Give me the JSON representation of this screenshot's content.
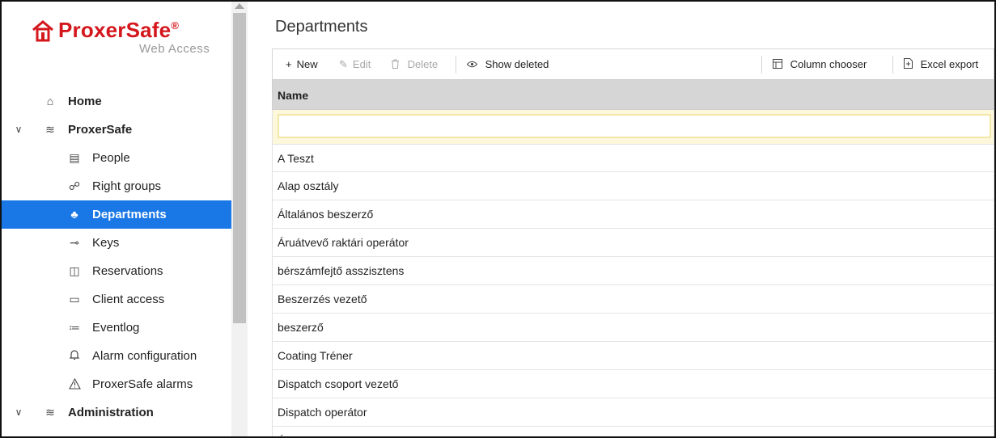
{
  "brand": {
    "name": "ProxerSafe",
    "registered": "®",
    "subtitle": "Web Access",
    "color": "#d4171d"
  },
  "sidebar": {
    "accent": "#1a78e6",
    "items": [
      {
        "label": "Home",
        "icon": "home-icon",
        "glyph": "⌂"
      },
      {
        "label": "ProxerSafe",
        "icon": "layers-icon",
        "glyph": "≋",
        "expanded": true
      },
      {
        "label": "People",
        "icon": "id-card-icon",
        "glyph": "▤"
      },
      {
        "label": "Right groups",
        "icon": "group-icon",
        "glyph": "☍"
      },
      {
        "label": "Departments",
        "icon": "sitemap-icon",
        "glyph": "♣",
        "active": true
      },
      {
        "label": "Keys",
        "icon": "key-icon",
        "glyph": "⊸"
      },
      {
        "label": "Reservations",
        "icon": "book-icon",
        "glyph": "◫"
      },
      {
        "label": "Client access",
        "icon": "keyboard-icon",
        "glyph": "▭"
      },
      {
        "label": "Eventlog",
        "icon": "list-icon",
        "glyph": "≔"
      },
      {
        "label": "Alarm configuration",
        "icon": "bell-icon",
        "glyph": "♫"
      },
      {
        "label": "ProxerSafe alarms",
        "icon": "warning-icon",
        "glyph": "⚠"
      },
      {
        "label": "Administration",
        "icon": "layers-icon",
        "glyph": "≋",
        "expanded": true
      }
    ]
  },
  "page": {
    "title": "Departments"
  },
  "toolbar": {
    "new": "New",
    "edit": "Edit",
    "delete": "Delete",
    "show_deleted": "Show deleted",
    "column_chooser": "Column chooser",
    "excel_export": "Excel export"
  },
  "grid": {
    "column": "Name",
    "filter_value": "",
    "rows": [
      "A Teszt",
      "Alap osztály",
      "Általános beszerző",
      "Áruátvevő raktári operátor",
      "bérszámfejtő asszisztens",
      "Beszerzés vezető",
      "beszerző",
      "Coating Tréner",
      "Dispatch csoport vezető",
      "Dispatch operátor",
      "Épület karbantartó"
    ]
  }
}
